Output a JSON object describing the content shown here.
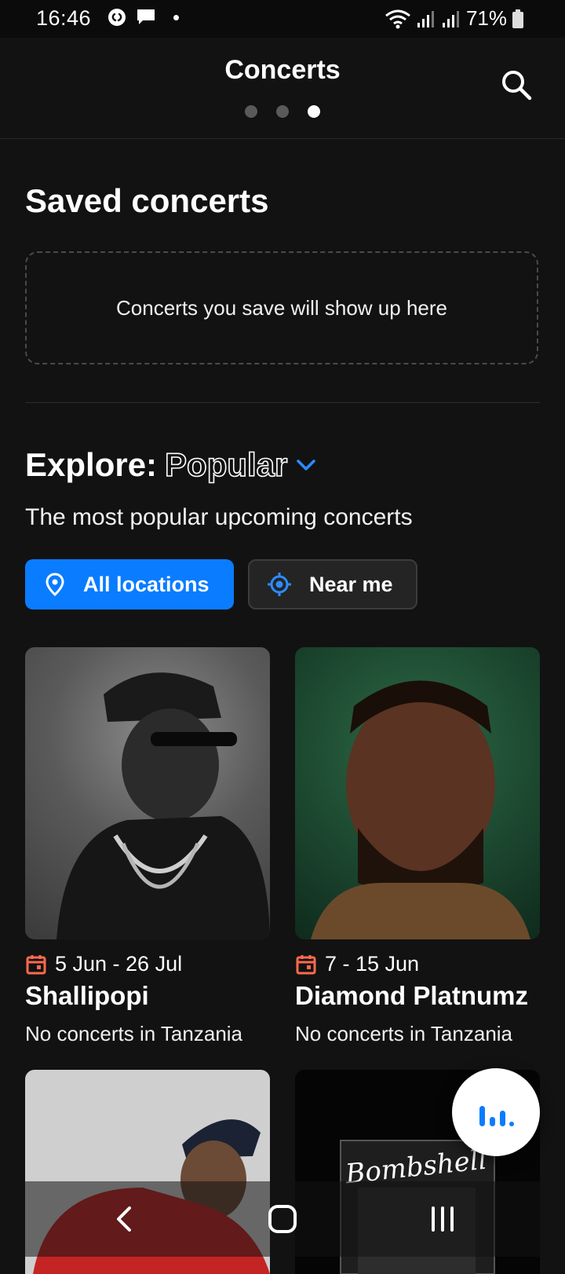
{
  "status_bar": {
    "time": "16:46",
    "battery": "71%",
    "left_icons": [
      "shazam-icon",
      "message-icon",
      "dot-icon"
    ],
    "right_icons": [
      "wifi-icon",
      "signal-icon",
      "signal-icon",
      "battery-icon"
    ]
  },
  "header": {
    "title": "Concerts",
    "page_count": 3,
    "active_page": 3,
    "search_icon": "search-icon"
  },
  "saved": {
    "title": "Saved concerts",
    "empty_message": "Concerts you save will show up here"
  },
  "explore": {
    "label": "Explore:",
    "value": "Popular",
    "subtitle": "The most popular upcoming concerts",
    "filters": [
      {
        "label": "All locations",
        "icon": "location-pin-icon",
        "selected": true
      },
      {
        "label": "Near me",
        "icon": "crosshair-icon",
        "selected": false
      }
    ]
  },
  "cards": [
    {
      "date": "5 Jun - 26 Jul",
      "name": "Shallipopi",
      "subtitle": "No concerts in Tanzania"
    },
    {
      "date": "7 - 15 Jun",
      "name": "Diamond Platnumz",
      "subtitle": "No concerts in Tanzania"
    },
    {
      "date": "",
      "name": "",
      "subtitle": ""
    },
    {
      "date": "",
      "name": "",
      "subtitle": "",
      "artwork_text": "Bombshell"
    }
  ],
  "colors": {
    "background": "#121212",
    "accent": "#0a7cff",
    "date_icon": "#ff6a4d"
  },
  "fab_icon": "audio-levels-icon",
  "nav": [
    "back-icon",
    "home-icon",
    "recents-icon"
  ]
}
